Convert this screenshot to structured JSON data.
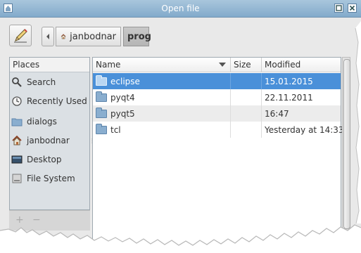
{
  "window": {
    "title": "Open file"
  },
  "breadcrumb": {
    "items": [
      "janbodnar",
      "prog"
    ]
  },
  "places": {
    "header": "Places",
    "items": [
      {
        "label": "Search",
        "icon": "search-icon"
      },
      {
        "label": "Recently Used",
        "icon": "recent-icon"
      },
      {
        "label": "dialogs",
        "icon": "folder-icon"
      },
      {
        "label": "janbodnar",
        "icon": "home-icon"
      },
      {
        "label": "Desktop",
        "icon": "desktop-icon"
      },
      {
        "label": "File System",
        "icon": "drive-icon"
      }
    ],
    "add": "+",
    "remove": "−"
  },
  "files": {
    "headers": {
      "name": "Name",
      "size": "Size",
      "modified": "Modified"
    },
    "rows": [
      {
        "name": "eclipse",
        "size": "",
        "modified": "15.01.2015",
        "selected": true
      },
      {
        "name": "pyqt4",
        "size": "",
        "modified": "22.11.2011"
      },
      {
        "name": "pyqt5",
        "size": "",
        "modified": "16:47"
      },
      {
        "name": "tcl",
        "size": "",
        "modified": "Yesterday at 14:33"
      }
    ]
  },
  "colors": {
    "titlebar": "#8fb4d2",
    "selection": "#4a90d9"
  }
}
